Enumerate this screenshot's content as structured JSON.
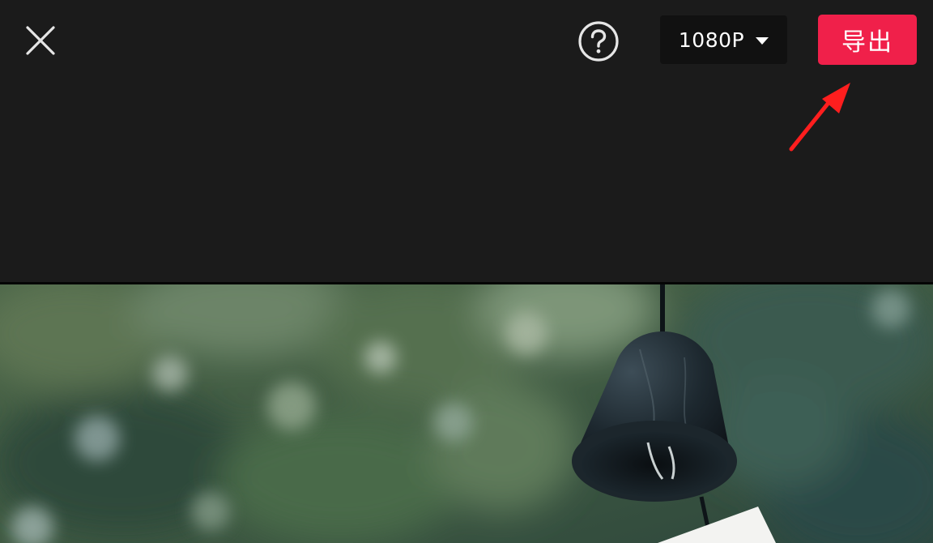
{
  "toolbar": {
    "close_icon": "close-icon",
    "help_icon": "question-circle-icon",
    "resolution": {
      "value": "1080P",
      "icon": "caret-down-icon"
    },
    "export_label": "导出",
    "export_color": "#f0204a"
  },
  "annotation": {
    "icon": "red-arrow-pointer",
    "color": "#ff1e1e"
  },
  "preview": {
    "description_icon": "video-frame-wind-chime"
  },
  "colors": {
    "background": "#1b1b1b",
    "button_bg": "#111111"
  }
}
